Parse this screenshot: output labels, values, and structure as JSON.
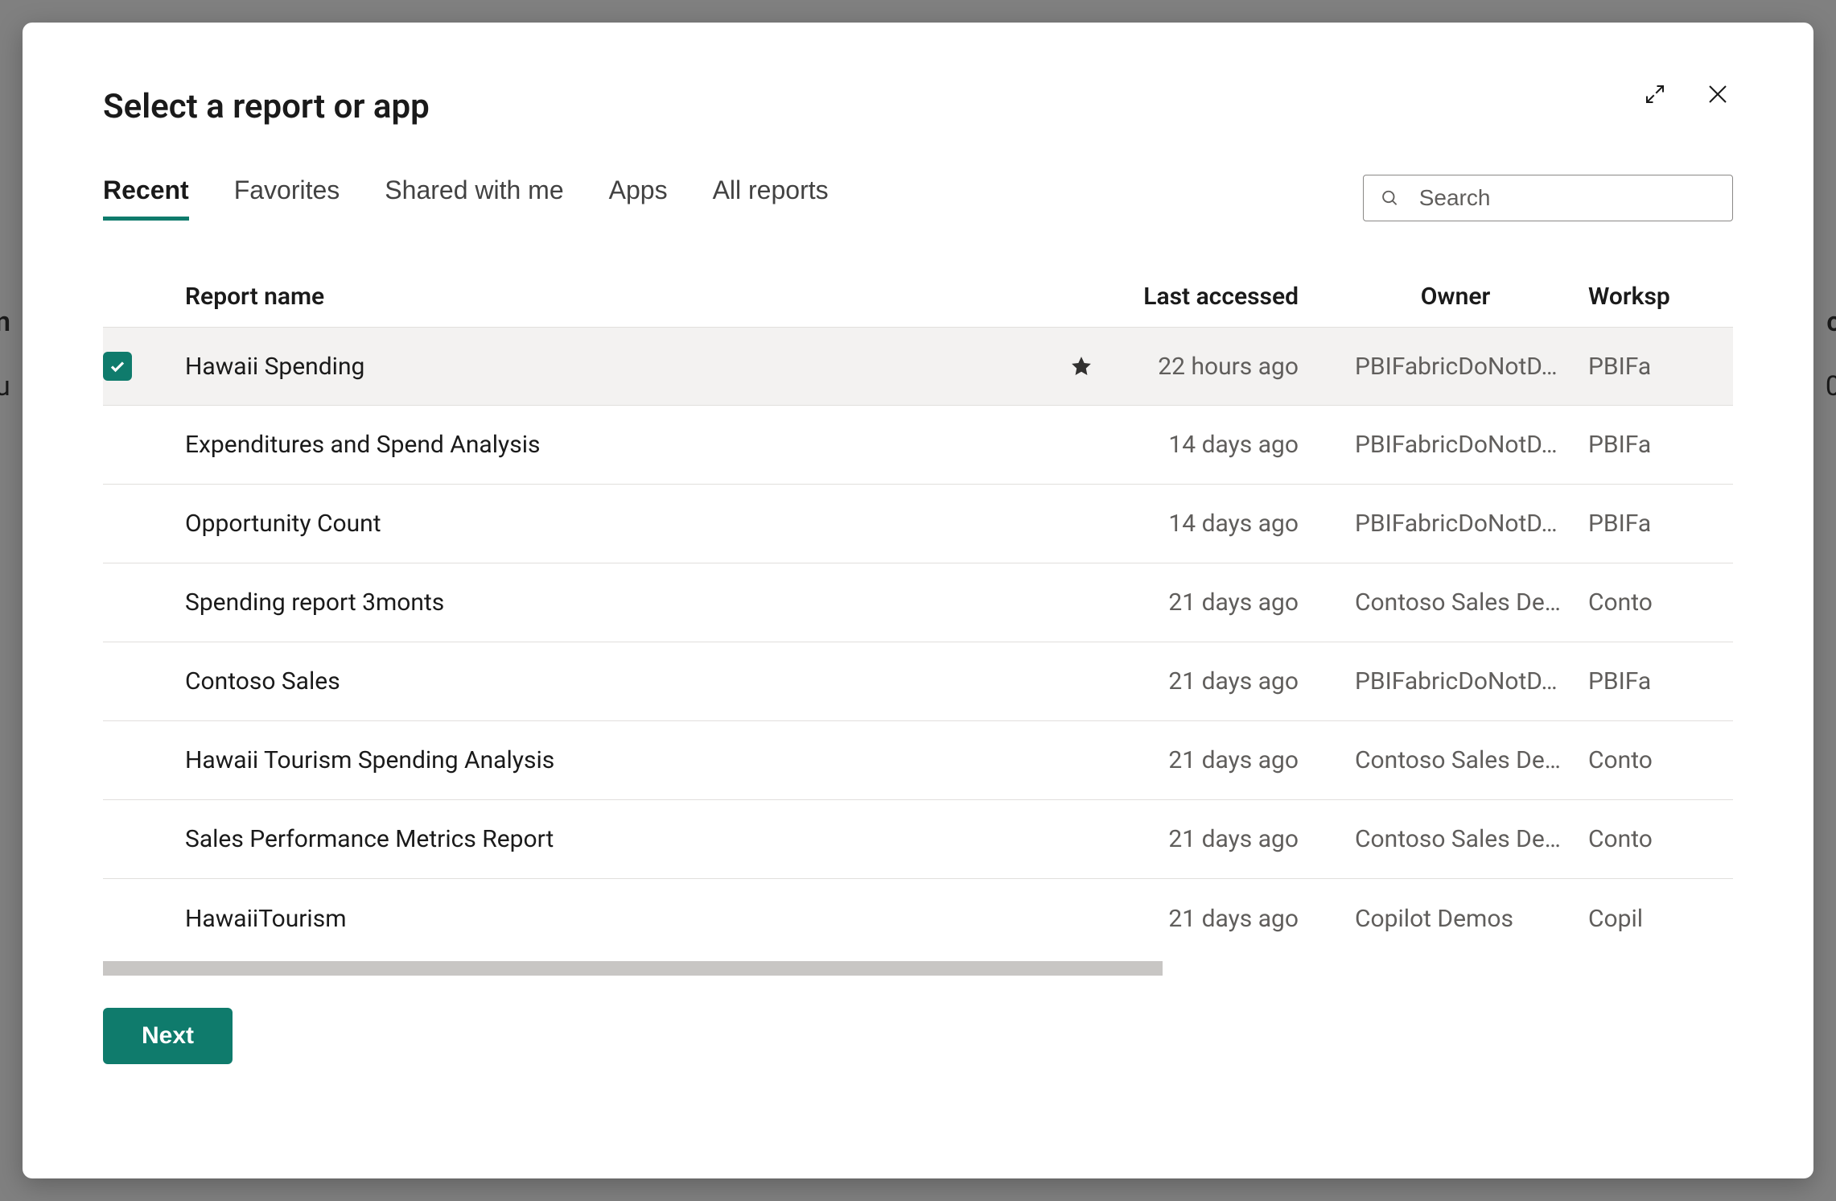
{
  "dialog": {
    "title": "Select a report or app",
    "next_button_label": "Next"
  },
  "tabs": [
    {
      "label": "Recent",
      "active": true
    },
    {
      "label": "Favorites",
      "active": false
    },
    {
      "label": "Shared with me",
      "active": false
    },
    {
      "label": "Apps",
      "active": false
    },
    {
      "label": "All reports",
      "active": false
    }
  ],
  "search": {
    "placeholder": "Search"
  },
  "columns": {
    "name": "Report name",
    "last_accessed": "Last accessed",
    "owner": "Owner",
    "workspace": "Worksp"
  },
  "rows": [
    {
      "selected": true,
      "favorite": true,
      "name": "Hawaii Spending",
      "last_accessed": "22 hours ago",
      "owner": "PBIFabricDoNotD…",
      "workspace": "PBIFa"
    },
    {
      "selected": false,
      "favorite": false,
      "name": "Expenditures and Spend Analysis",
      "last_accessed": "14 days ago",
      "owner": "PBIFabricDoNotD…",
      "workspace": "PBIFa"
    },
    {
      "selected": false,
      "favorite": false,
      "name": "Opportunity Count",
      "last_accessed": "14 days ago",
      "owner": "PBIFabricDoNotD…",
      "workspace": "PBIFa"
    },
    {
      "selected": false,
      "favorite": false,
      "name": "Spending report 3monts",
      "last_accessed": "21 days ago",
      "owner": "Contoso Sales De…",
      "workspace": "Conto"
    },
    {
      "selected": false,
      "favorite": false,
      "name": "Contoso Sales",
      "last_accessed": "21 days ago",
      "owner": "PBIFabricDoNotD…",
      "workspace": "PBIFa"
    },
    {
      "selected": false,
      "favorite": false,
      "name": "Hawaii Tourism Spending Analysis",
      "last_accessed": "21 days ago",
      "owner": "Contoso Sales De…",
      "workspace": "Conto"
    },
    {
      "selected": false,
      "favorite": false,
      "name": "Sales Performance Metrics Report",
      "last_accessed": "21 days ago",
      "owner": "Contoso Sales De…",
      "workspace": "Conto"
    },
    {
      "selected": false,
      "favorite": false,
      "name": "HawaiiTourism",
      "last_accessed": "21 days ago",
      "owner": "Copilot Demos",
      "workspace": "Copil"
    }
  ]
}
